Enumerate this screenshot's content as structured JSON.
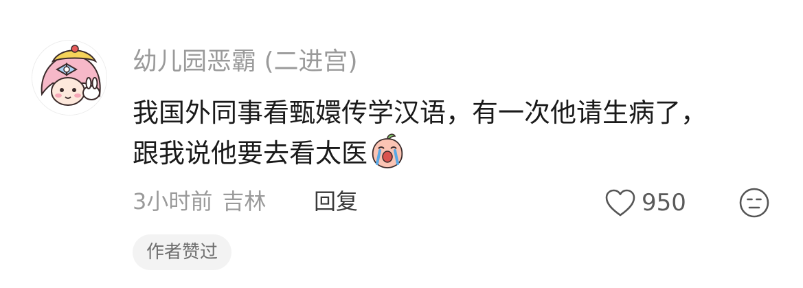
{
  "comment": {
    "avatar_icon": "cartoon-girl-avatar",
    "username": "幼儿园恶霸 (二进宫)",
    "content_lines": [
      "我国外同事看甄嬛传学汉语，有一次他请生病了，",
      "跟我说他要去看太医"
    ],
    "content_emoji": "crying-peach-emoji",
    "time": "3小时前",
    "location": "吉林",
    "reply_label": "回复",
    "like_icon": "heart-outline-icon",
    "like_count": "950",
    "dislike_icon": "meh-face-icon",
    "author_liked_label": "作者赞过",
    "colors": {
      "username": "#9a9a9a",
      "text": "#1a1a1a",
      "meta": "#9a9a9a",
      "badge_bg": "#f3f3f3"
    }
  }
}
